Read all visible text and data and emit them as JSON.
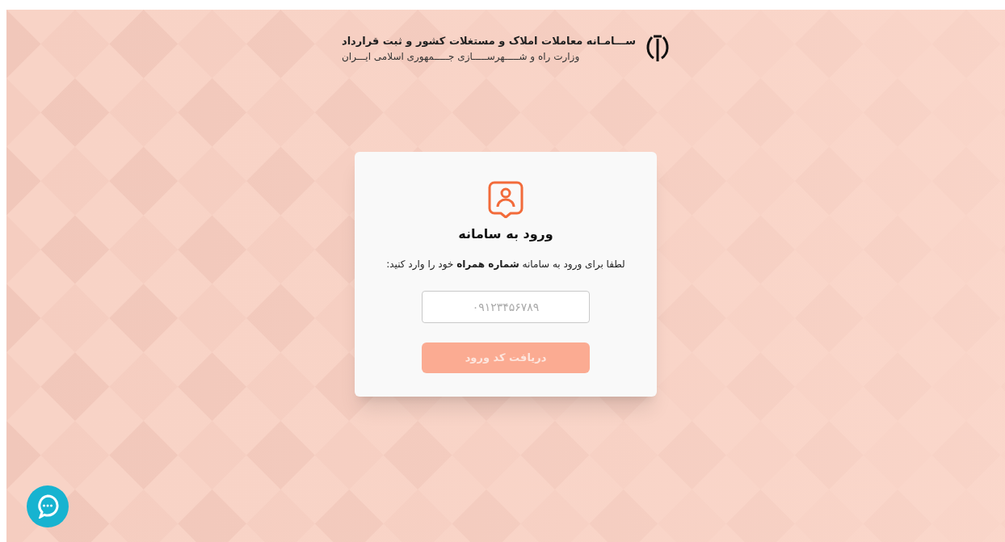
{
  "header": {
    "title": "ســـامـانه معاملات املاک و مستغلات کشور و ثبت قرارداد",
    "subtitle": "وزارت راه و شـــــهرســـــازی جـــــمهوری اسلامی ایـــران"
  },
  "login_card": {
    "heading": "ورود به سامانه",
    "instruction": "لطفا برای ورود به سامانه **شماره همراه** خود را وارد کنید:",
    "phone_field": {
      "placeholder": "۰۹۱۲۳۴۵۶۷۸۹"
    },
    "submit_button": {
      "label": "دریافت کد ورود",
      "disabled": true
    }
  }
}
